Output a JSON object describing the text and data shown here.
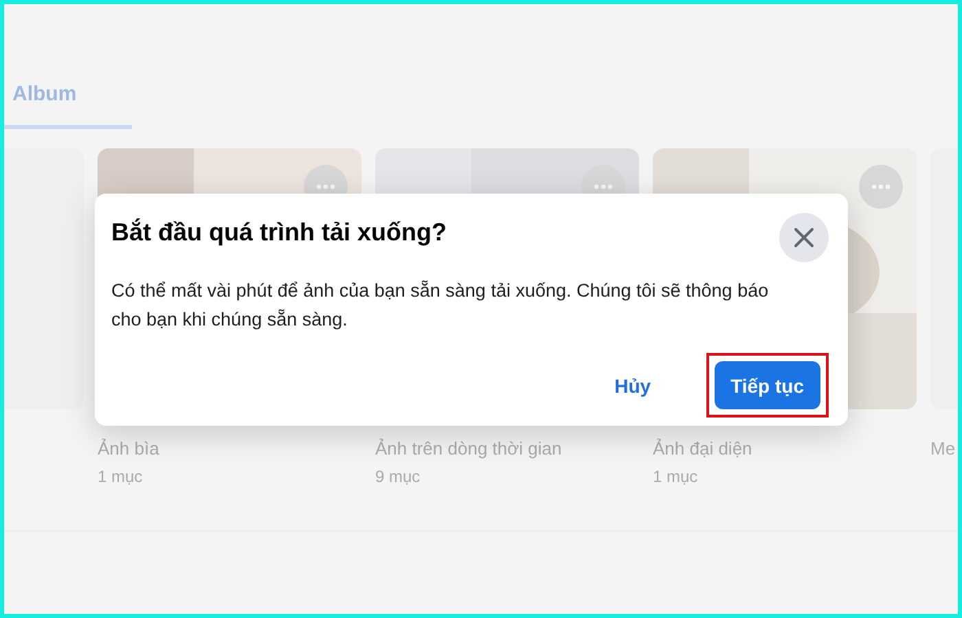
{
  "tabs": [
    {
      "label": "Album",
      "selected": true
    }
  ],
  "albums": [
    {
      "name": "Ảnh bìa",
      "count": "1 mục"
    },
    {
      "name": "Ảnh trên dòng thời gian",
      "count": "9 mục"
    },
    {
      "name": "Ảnh đại diện",
      "count": "1 mục"
    },
    {
      "kind": "blank",
      "name": "Me"
    }
  ],
  "dialog": {
    "title": "Bắt đầu quá trình tải xuống?",
    "message": "Có thể mất vài phút để ảnh của bạn sẵn sàng tải xuống. Chúng tôi sẽ thông báo cho bạn khi chúng sẵn sàng.",
    "actions": [
      {
        "kind": "text",
        "label": "Hủy",
        "highlighted": false
      },
      {
        "kind": "primary",
        "label": "Tiếp tục",
        "highlighted": true
      }
    ]
  }
}
